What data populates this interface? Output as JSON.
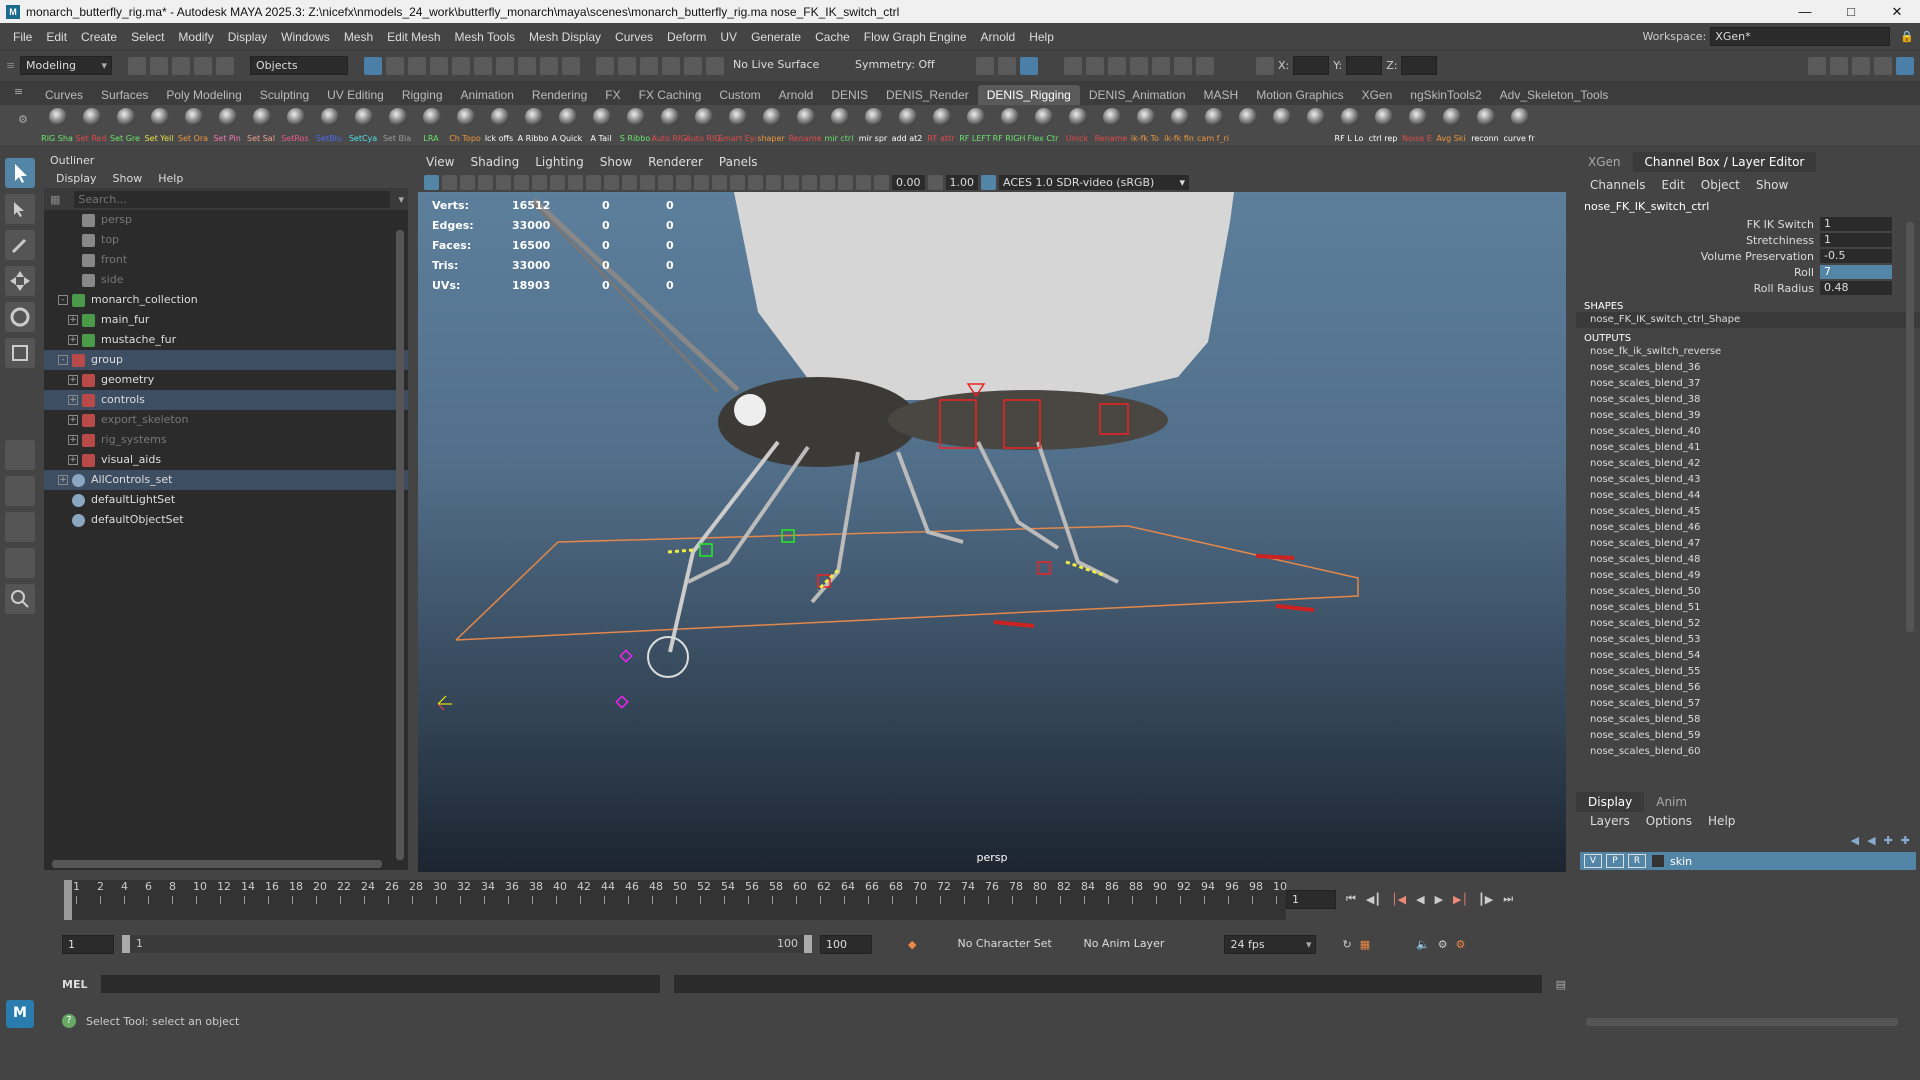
{
  "title": {
    "text": "monarch_butterfly_rig.ma* - Autodesk MAYA 2025.3: Z:\\nicefx\\nmodels_24_work\\butterfly_monarch\\maya\\scenes\\monarch_butterfly_rig.ma    nose_FK_IK_switch_ctrl"
  },
  "menu": {
    "items": [
      "File",
      "Edit",
      "Create",
      "Select",
      "Modify",
      "Display",
      "Windows",
      "Mesh",
      "Edit Mesh",
      "Mesh Tools",
      "Mesh Display",
      "Curves",
      "Deform",
      "UV",
      "Generate",
      "Cache",
      "Flow Graph Engine",
      "Arnold",
      "Help"
    ],
    "workspace_label": "Workspace:",
    "workspace_value": "XGen*"
  },
  "status": {
    "mode": "Modeling",
    "selection_mode": "Objects",
    "live_surface": "No Live Surface",
    "symmetry": "Symmetry: Off",
    "x_label": "X:",
    "y_label": "Y:",
    "z_label": "Z:"
  },
  "shelf": {
    "tabs": [
      "Curves",
      "Surfaces",
      "Poly Modeling",
      "Sculpting",
      "UV Editing",
      "Rigging",
      "Animation",
      "Rendering",
      "FX",
      "FX Caching",
      "Custom",
      "Arnold",
      "DENIS",
      "DENIS_Render",
      "DENIS_Rigging",
      "DENIS_Animation",
      "MASH",
      "Motion Graphics",
      "XGen",
      "ngSkinTools2",
      "Adv_Skeleton_Tools"
    ],
    "active_tab": "DENIS_Rigging",
    "buttons": [
      {
        "label": "RIG Sha",
        "color": "#6ce26c"
      },
      {
        "label": "Set Red",
        "color": "#e24a4a"
      },
      {
        "label": "Set Gre",
        "color": "#6ce26c"
      },
      {
        "label": "Set Yell",
        "color": "#e8e04a"
      },
      {
        "label": "Set Ora",
        "color": "#f0963c"
      },
      {
        "label": "Set Pin",
        "color": "#f07ab4"
      },
      {
        "label": "Set Sal",
        "color": "#f0a090"
      },
      {
        "label": "SetRos",
        "color": "#f05a8c"
      },
      {
        "label": "SetBlu",
        "color": "#4a6af0"
      },
      {
        "label": "SetCya",
        "color": "#4ae0e8"
      },
      {
        "label": "Set Bla",
        "color": "#999999"
      },
      {
        "label": "LRA",
        "color": "#6ce26c"
      },
      {
        "label": "Ch Topo",
        "color": "#f0963c"
      },
      {
        "label": "lck offs",
        "color": "#ffffff"
      },
      {
        "label": "A Ribbo",
        "color": "#ffffff"
      },
      {
        "label": "A Quick",
        "color": "#ffffff"
      },
      {
        "label": "A Tail",
        "color": "#ffffff"
      },
      {
        "label": "S Ribbo",
        "color": "#6ce26c"
      },
      {
        "label": "Auto RIG",
        "color": "#e24a4a"
      },
      {
        "label": "Auto RIG",
        "color": "#e24a4a"
      },
      {
        "label": "Smart Eye RIG",
        "color": "#e24a4a"
      },
      {
        "label": "shaper",
        "color": "#f0963c"
      },
      {
        "label": "Rename",
        "color": "#e24a4a"
      },
      {
        "label": "mir ctrl",
        "color": "#6ce26c"
      },
      {
        "label": "mir spr",
        "color": "#ffffff"
      },
      {
        "label": "add at2",
        "color": "#ffffff"
      },
      {
        "label": "RF attr",
        "color": "#e24a4a"
      },
      {
        "label": "RF LEFT",
        "color": "#6ce26c"
      },
      {
        "label": "RF RIGH",
        "color": "#6ce26c"
      },
      {
        "label": "Flex Ctr",
        "color": "#6ce26c"
      },
      {
        "label": "Unlck",
        "color": "#e24a4a"
      },
      {
        "label": "Rename",
        "color": "#e24a4a"
      },
      {
        "label": "ik-fk To",
        "color": "#f0963c"
      },
      {
        "label": "ik-fk fin",
        "color": "#f0963c"
      },
      {
        "label": "cam f_ri",
        "color": "#f0963c"
      },
      {
        "label": "",
        "color": "#ffffff"
      },
      {
        "label": "",
        "color": "#ffffff"
      },
      {
        "label": "",
        "color": "#ffffff"
      },
      {
        "label": "RF L Lo",
        "color": "#ffffff"
      },
      {
        "label": "ctrl rep",
        "color": "#ffffff"
      },
      {
        "label": "Noise E",
        "color": "#e24a4a"
      },
      {
        "label": "Avg Ski",
        "color": "#f0963c"
      },
      {
        "label": "reconn",
        "color": "#ffffff"
      },
      {
        "label": "curve fr",
        "color": "#ffffff"
      }
    ]
  },
  "outliner": {
    "title": "Outliner",
    "menus": [
      "Display",
      "Show",
      "Help"
    ],
    "search_placeholder": "Search...",
    "rows": [
      {
        "label": "persp",
        "indent": 1,
        "icon": "camera",
        "dim": true,
        "expand": ""
      },
      {
        "label": "top",
        "indent": 1,
        "icon": "camera",
        "dim": true,
        "expand": ""
      },
      {
        "label": "front",
        "indent": 1,
        "icon": "camera",
        "dim": true,
        "expand": ""
      },
      {
        "label": "side",
        "indent": 1,
        "icon": "camera",
        "dim": true,
        "expand": ""
      },
      {
        "label": "monarch_collection",
        "indent": 0,
        "icon": "xgen",
        "dim": false,
        "expand": "-"
      },
      {
        "label": "main_fur",
        "indent": 1,
        "icon": "xgen",
        "dim": false,
        "expand": "+"
      },
      {
        "label": "mustache_fur",
        "indent": 1,
        "icon": "xgen",
        "dim": false,
        "expand": "+"
      },
      {
        "label": "group",
        "indent": 0,
        "icon": "transform",
        "dim": false,
        "expand": "-",
        "highlight": true
      },
      {
        "label": "geometry",
        "indent": 1,
        "icon": "transform",
        "dim": false,
        "expand": "+"
      },
      {
        "label": "controls",
        "indent": 1,
        "icon": "transform",
        "dim": false,
        "expand": "+",
        "highlight": true
      },
      {
        "label": "export_skeleton",
        "indent": 1,
        "icon": "transform",
        "dim": true,
        "expand": "+"
      },
      {
        "label": "rig_systems",
        "indent": 1,
        "icon": "transform",
        "dim": true,
        "expand": "+"
      },
      {
        "label": "visual_aids",
        "indent": 1,
        "icon": "transform",
        "dim": false,
        "expand": "+"
      },
      {
        "label": "AllControls_set",
        "indent": 0,
        "icon": "set",
        "dim": false,
        "expand": "+",
        "highlight": true
      },
      {
        "label": "defaultLightSet",
        "indent": 0,
        "icon": "set",
        "dim": false,
        "expand": ""
      },
      {
        "label": "defaultObjectSet",
        "indent": 0,
        "icon": "set",
        "dim": false,
        "expand": ""
      }
    ]
  },
  "viewport": {
    "menus": [
      "View",
      "Shading",
      "Lighting",
      "Show",
      "Renderer",
      "Panels"
    ],
    "field1": "0.00",
    "field2": "1.00",
    "colorspace": "ACES 1.0 SDR-video (sRGB)",
    "camera": "persp",
    "hud": [
      {
        "label": "Verts:",
        "v1": "16512",
        "v2": "0",
        "v3": "0"
      },
      {
        "label": "Edges:",
        "v1": "33000",
        "v2": "0",
        "v3": "0"
      },
      {
        "label": "Faces:",
        "v1": "16500",
        "v2": "0",
        "v3": "0"
      },
      {
        "label": "Tris:",
        "v1": "33000",
        "v2": "0",
        "v3": "0"
      },
      {
        "label": "UVs:",
        "v1": "18903",
        "v2": "0",
        "v3": "0"
      }
    ]
  },
  "channel_box": {
    "tabs": [
      "XGen",
      "Channel Box / Layer Editor"
    ],
    "menus": [
      "Channels",
      "Edit",
      "Object",
      "Show"
    ],
    "object_name": "nose_FK_IK_switch_ctrl",
    "attributes": [
      {
        "name": "FK IK Switch",
        "value": "1",
        "highlight": false
      },
      {
        "name": "Stretchiness",
        "value": "1",
        "highlight": false
      },
      {
        "name": "Volume Preservation",
        "value": "-0.5",
        "highlight": false
      },
      {
        "name": "Roll",
        "value": "7",
        "highlight": true
      },
      {
        "name": "Roll Radius",
        "value": "0.48",
        "highlight": false
      }
    ],
    "shapes_label": "SHAPES",
    "shape_name": "nose_FK_IK_switch_ctrl_Shape",
    "outputs_label": "OUTPUTS",
    "outputs": [
      "nose_fk_ik_switch_reverse",
      "nose_scales_blend_36",
      "nose_scales_blend_37",
      "nose_scales_blend_38",
      "nose_scales_blend_39",
      "nose_scales_blend_40",
      "nose_scales_blend_41",
      "nose_scales_blend_42",
      "nose_scales_blend_43",
      "nose_scales_blend_44",
      "nose_scales_blend_45",
      "nose_scales_blend_46",
      "nose_scales_blend_47",
      "nose_scales_blend_48",
      "nose_scales_blend_49",
      "nose_scales_blend_50",
      "nose_scales_blend_51",
      "nose_scales_blend_52",
      "nose_scales_blend_53",
      "nose_scales_blend_54",
      "nose_scales_blend_55",
      "nose_scales_blend_56",
      "nose_scales_blend_57",
      "nose_scales_blend_58",
      "nose_scales_blend_59",
      "nose_scales_blend_60"
    ]
  },
  "layer_editor": {
    "tabs": [
      "Display",
      "Anim"
    ],
    "menus": [
      "Layers",
      "Options",
      "Help"
    ],
    "layer": {
      "v": "V",
      "p": "P",
      "r": "R",
      "name": "skin"
    }
  },
  "timeline": {
    "ticks": [
      "1",
      "2",
      "4",
      "6",
      "8",
      "10",
      "12",
      "14",
      "16",
      "18",
      "20",
      "22",
      "24",
      "26",
      "28",
      "30",
      "32",
      "34",
      "36",
      "38",
      "40",
      "42",
      "44",
      "46",
      "48",
      "50",
      "52",
      "54",
      "56",
      "58",
      "60",
      "62",
      "64",
      "66",
      "68",
      "70",
      "72",
      "74",
      "76",
      "78",
      "80",
      "82",
      "84",
      "86",
      "88",
      "90",
      "92",
      "94",
      "96",
      "98",
      "10"
    ],
    "current_frame": "1"
  },
  "range": {
    "start": "1",
    "inner_start": "1",
    "inner_end": "100",
    "end": "100",
    "character_set": "No Character Set",
    "anim_layer": "No Anim Layer",
    "fps": "24 fps"
  },
  "command": {
    "label": "MEL"
  },
  "help_line": {
    "text": "Select Tool: select an object"
  }
}
